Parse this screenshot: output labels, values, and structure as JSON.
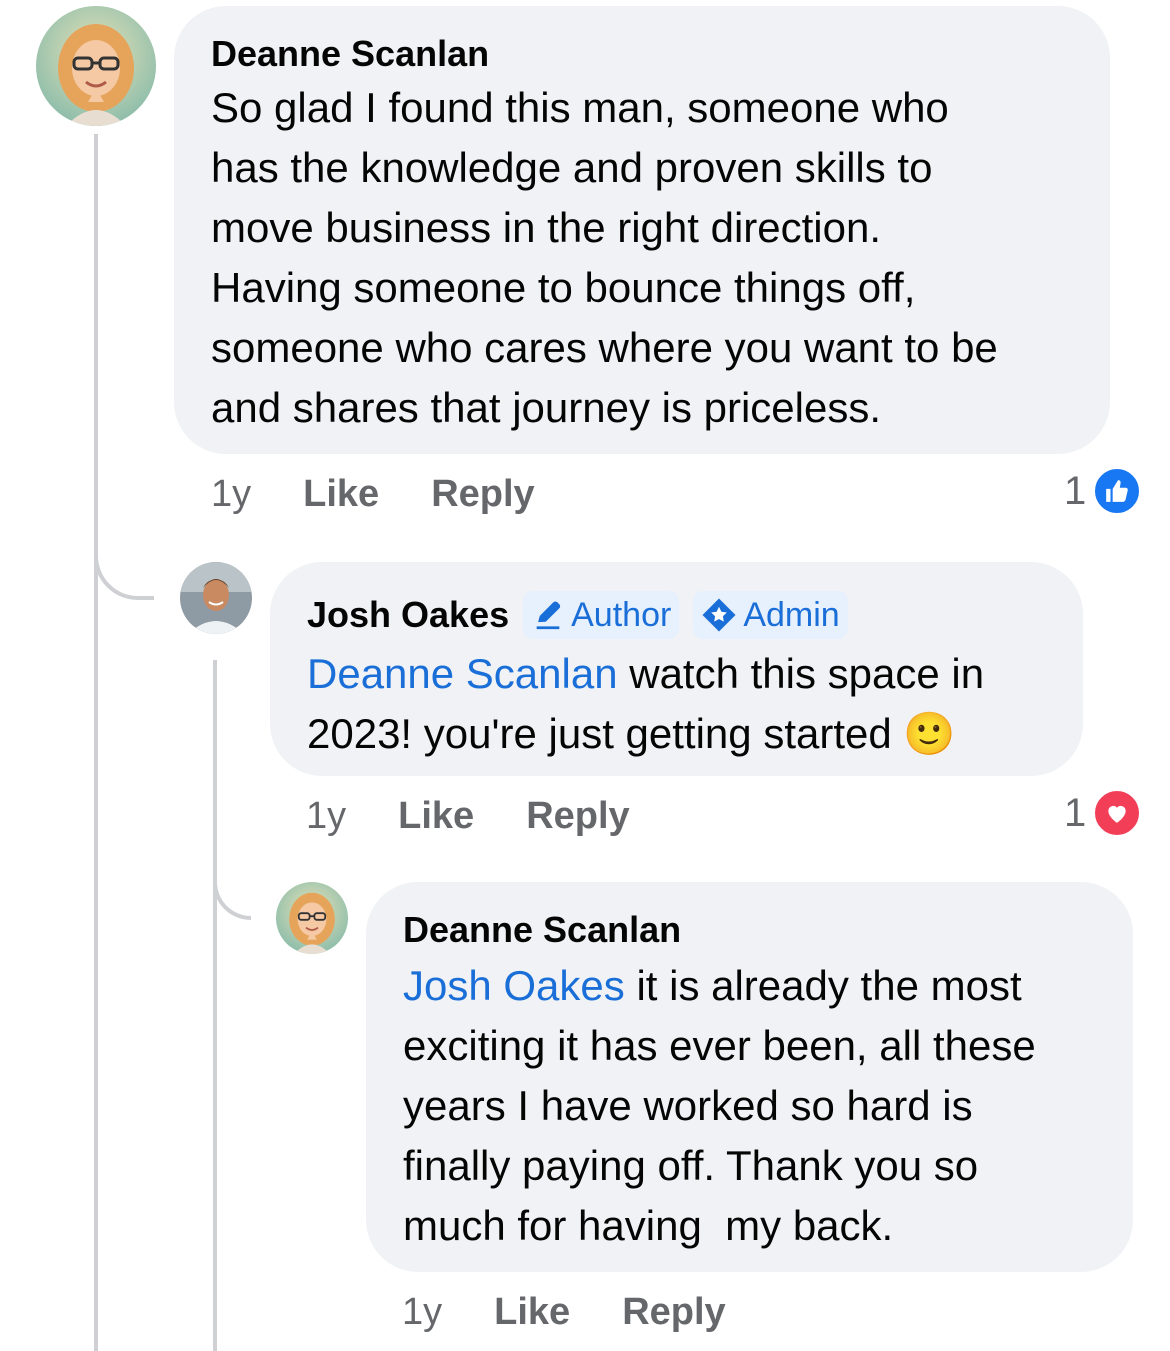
{
  "comments": [
    {
      "author": "Deanne Scanlan",
      "text": "So glad I found this man, someone who has the knowledge and proven skills to move business in the right direction. Having someone to bounce things off, someone who cares where you want to be and shares that journey is priceless.",
      "lines": [
        "So glad I found this man, someone who",
        "has the knowledge and proven skills to",
        "move business in the right direction.",
        "Having someone to bounce things off,",
        "someone who cares where you want to be",
        "and shares that journey is priceless."
      ],
      "time": "1y",
      "like_label": "Like",
      "reply_label": "Reply",
      "reaction_count": "1",
      "reaction_icon": "like-icon",
      "reaction_color": "#1877f2"
    },
    {
      "author": "Josh Oakes",
      "badges": {
        "author": "Author",
        "admin": "Admin"
      },
      "mention": "Deanne Scanlan",
      "line1_rest": " watch this space in",
      "line2": "2023! you're just getting started ",
      "emoji": "🙂",
      "time": "1y",
      "like_label": "Like",
      "reply_label": "Reply",
      "reaction_count": "1",
      "reaction_icon": "love-icon",
      "reaction_color": "#f33e58"
    },
    {
      "author": "Deanne Scanlan",
      "mention": "Josh Oakes",
      "line1_rest": " it is already the most",
      "lines": [
        "exciting it has ever been, all these",
        "years I have worked so hard is",
        "finally paying off. Thank you so",
        "much for having  my back."
      ],
      "time": "1y",
      "like_label": "Like",
      "reply_label": "Reply"
    }
  ],
  "colors": {
    "bubble": "#f0f2f5",
    "mention": "#1a6ed8",
    "meta": "#65676b",
    "thread": "#ced0d4"
  }
}
